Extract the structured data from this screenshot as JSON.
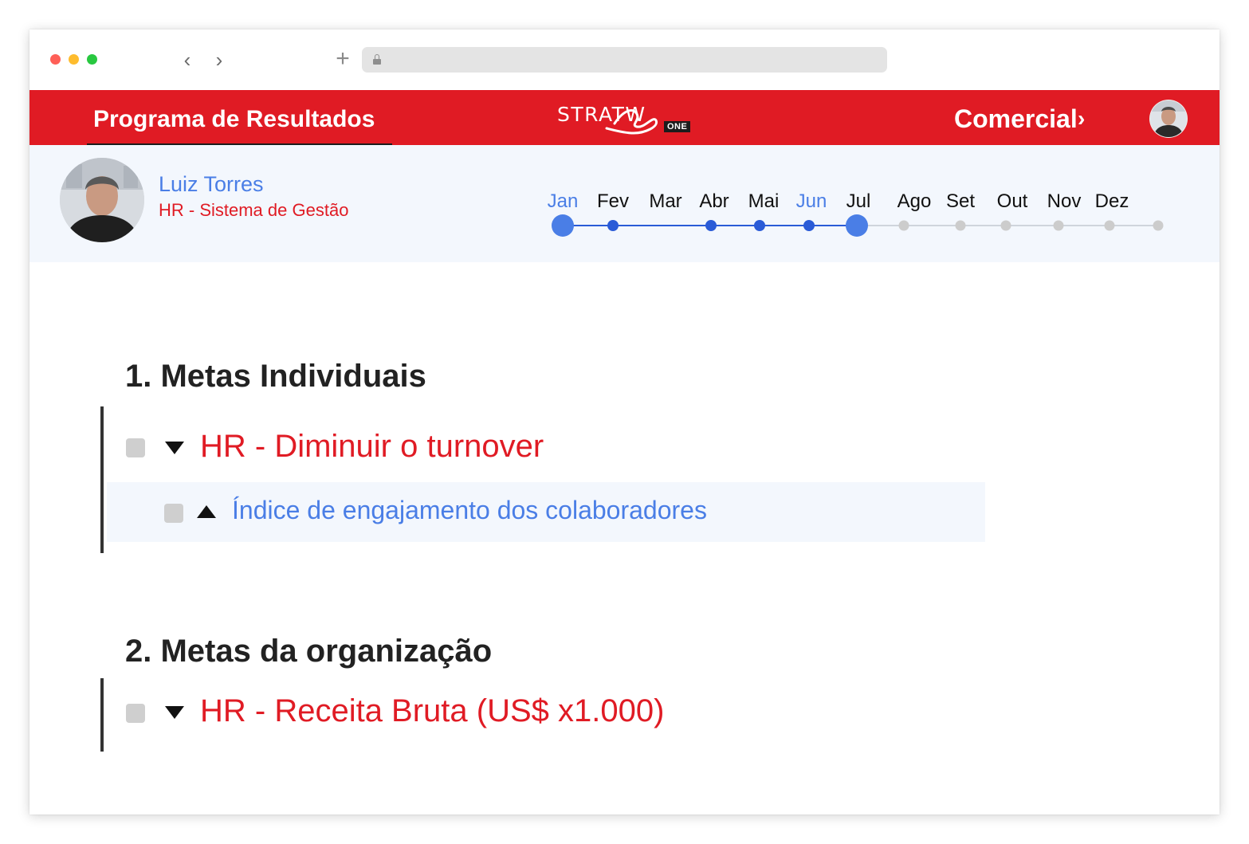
{
  "header": {
    "program_title": "Programa de Resultados",
    "logo_text": "STRATW",
    "logo_badge": "ONE",
    "area_link": "Comercial",
    "area_chevron": "›"
  },
  "user": {
    "name": "Luiz Torres",
    "role": "HR - Sistema de Gestão"
  },
  "timeline": {
    "months": [
      {
        "label": "Jan",
        "highlighted": true,
        "status": "current-large"
      },
      {
        "label": "Fev",
        "highlighted": false,
        "status": "done"
      },
      {
        "label": "Mar",
        "highlighted": false,
        "status": "none"
      },
      {
        "label": "Abr",
        "highlighted": false,
        "status": "done"
      },
      {
        "label": "Mai",
        "highlighted": false,
        "status": "done"
      },
      {
        "label": "Jun",
        "highlighted": true,
        "status": "done"
      },
      {
        "label": "Jul",
        "highlighted": false,
        "status": "current-large"
      },
      {
        "label": "Ago",
        "highlighted": false,
        "status": "pending"
      },
      {
        "label": "Set",
        "highlighted": false,
        "status": "pending"
      },
      {
        "label": "Out",
        "highlighted": false,
        "status": "pending"
      },
      {
        "label": "Nov",
        "highlighted": false,
        "status": "pending"
      },
      {
        "label": "Dez",
        "highlighted": false,
        "status": "pending"
      }
    ],
    "colors": {
      "large_dot": "#4a7ee6",
      "done_dot": "#2a5bd7",
      "pending_dot": "#cccccc",
      "done_line": "#2a5bd7",
      "pending_line": "#cfd4dc"
    }
  },
  "sections": {
    "individual_title": "1. Metas Individuais",
    "individual_goal": "HR - Diminuir o turnover",
    "individual_kpi": "Índice de engajamento dos colaboradores",
    "organization_title": "2. Metas da organização",
    "organization_goal": "HR - Receita Bruta (US$ x1.000)"
  },
  "colors": {
    "brand_red": "#e01b24",
    "accent_blue": "#4a7ee6",
    "strip_bg": "#f3f7fd"
  }
}
